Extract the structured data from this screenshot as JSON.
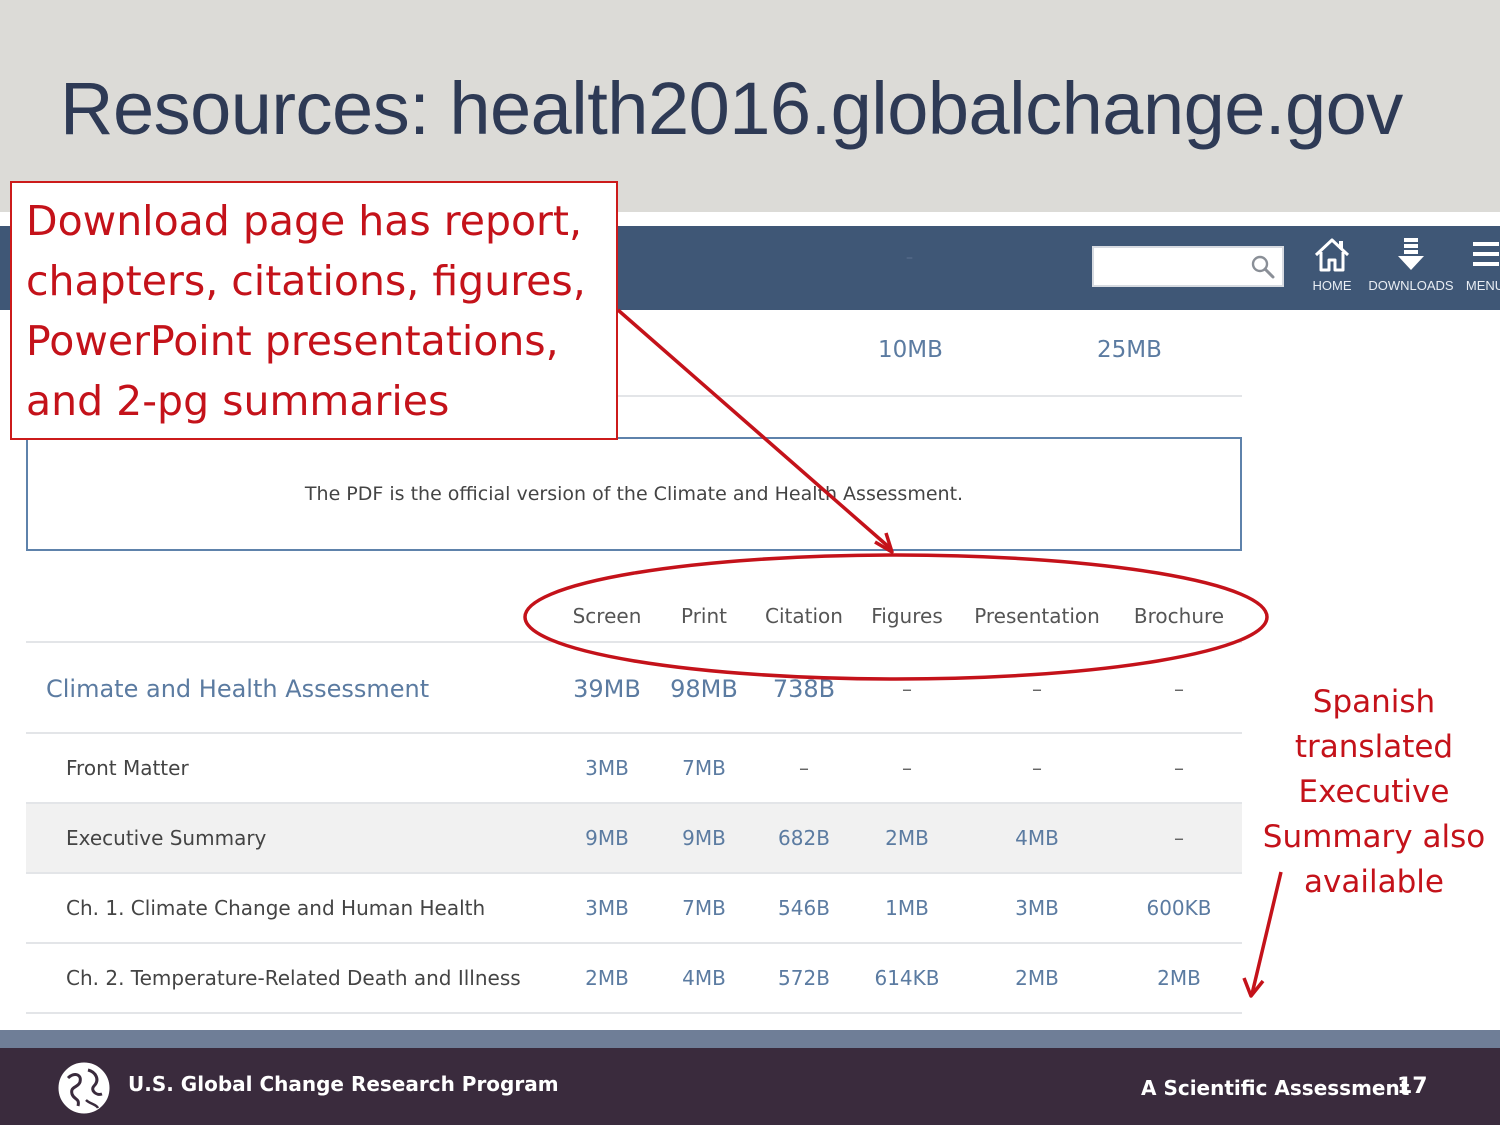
{
  "slide": {
    "title": "Resources: health2016.globalchange.gov",
    "page_number": "17"
  },
  "callout": {
    "lines": [
      "Download page has report,",
      "chapters, citations, figures,",
      "PowerPoint presentations,",
      "and 2-pg summaries"
    ]
  },
  "side_note": {
    "lines": [
      "Spanish",
      "translated",
      "Executive",
      "Summary also",
      "available"
    ]
  },
  "site": {
    "nav_dash": "–",
    "nav": {
      "home_label": "HOME",
      "downloads_label": "DOWNLOADS",
      "menu_label": "MENU"
    },
    "top_sizes": [
      "10MB",
      "25MB"
    ],
    "notice": "The PDF is the official version of the Climate and Health Assessment.",
    "columns": [
      "Screen",
      "Print",
      "Citation",
      "Figures",
      "Presentation",
      "Brochure"
    ],
    "rows": [
      {
        "title": "Climate and Health Assessment",
        "cells": [
          "39MB",
          "98MB",
          "738B",
          "–",
          "–",
          "–"
        ]
      },
      {
        "title": "Front Matter",
        "cells": [
          "3MB",
          "7MB",
          "–",
          "–",
          "–",
          "–"
        ]
      },
      {
        "title": "Executive Summary",
        "cells": [
          "9MB",
          "9MB",
          "682B",
          "2MB",
          "4MB",
          "–"
        ]
      },
      {
        "title": "Ch. 1. Climate Change and Human Health",
        "cells": [
          "3MB",
          "7MB",
          "546B",
          "1MB",
          "3MB",
          "600KB"
        ]
      },
      {
        "title": "Ch. 2. Temperature-Related Death and Illness",
        "cells": [
          "2MB",
          "4MB",
          "572B",
          "614KB",
          "2MB",
          "2MB"
        ]
      }
    ]
  },
  "footer": {
    "org": "U.S. Global Change Research Program",
    "tagline": "A Scientific Assessment"
  },
  "colors": {
    "title": "#2e3a55",
    "accent_red": "#c4121a",
    "nav_bg": "#3f5776",
    "link_blue": "#5b7ba1",
    "footer_bg": "#3a2b3d"
  },
  "icons": [
    "search-icon",
    "home-icon",
    "download-icon",
    "menu-icon",
    "globe-icon",
    "arrow-icon"
  ]
}
